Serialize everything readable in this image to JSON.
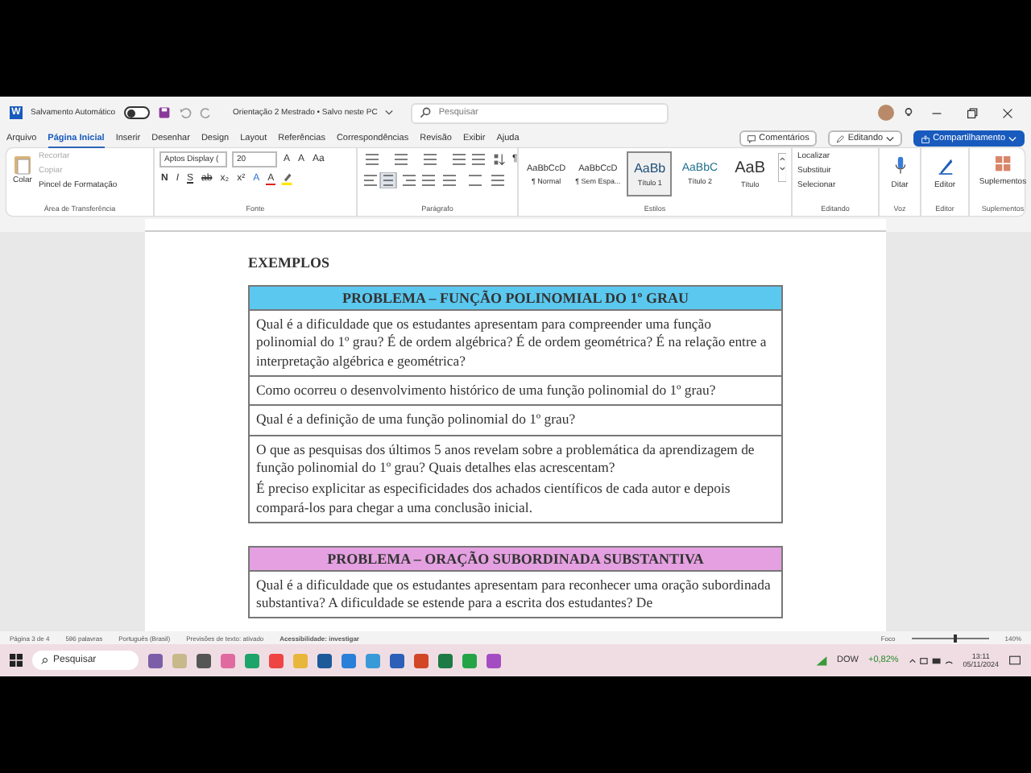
{
  "window": {
    "app_logo": "W",
    "autosave_label": "Salvamento Automático",
    "autosave_on": false,
    "doc_title": "Orientação 2 Mestrado • Salvo neste PC",
    "search_placeholder": "Pesquisar"
  },
  "tabs": [
    {
      "label": "Arquivo",
      "selected": false
    },
    {
      "label": "Página Inicial",
      "selected": true
    },
    {
      "label": "Inserir",
      "selected": false
    },
    {
      "label": "Desenhar",
      "selected": false
    },
    {
      "label": "Design",
      "selected": false
    },
    {
      "label": "Layout",
      "selected": false
    },
    {
      "label": "Referências",
      "selected": false
    },
    {
      "label": "Correspondências",
      "selected": false
    },
    {
      "label": "Revisão",
      "selected": false
    },
    {
      "label": "Exibir",
      "selected": false
    },
    {
      "label": "Ajuda",
      "selected": false
    }
  ],
  "top_buttons": {
    "comments": "Comentários",
    "editing": "Editando",
    "share": "Compartilhamento"
  },
  "clipboard": {
    "paste": "Colar",
    "items": [
      {
        "label": "Recortar",
        "disabled": true
      },
      {
        "label": "Copiar",
        "disabled": true
      },
      {
        "label": "Pincel de Formatação",
        "disabled": false
      }
    ],
    "group": "Área de Transferência"
  },
  "font": {
    "name": "Aptos Display (",
    "size": "20",
    "size_buttons": [
      "A",
      "A",
      "Aa"
    ],
    "format_buttons": [
      "N",
      "I",
      "S",
      "ab",
      "x₂",
      "x²",
      "A",
      "A"
    ],
    "group": "Fonte"
  },
  "paragraph": {
    "pilcrow": "¶",
    "group": "Parágrafo"
  },
  "styles": {
    "items": [
      {
        "preview": "AaBbCcD",
        "name": "¶ Normal",
        "selected": false
      },
      {
        "preview": "AaBbCcD",
        "name": "¶ Sem Espa...",
        "selected": false
      },
      {
        "preview": "AaBb",
        "name": "Título 1",
        "selected": true
      },
      {
        "preview": "AaBbC",
        "name": "Título 2",
        "selected": false
      },
      {
        "preview": "AaB",
        "name": "Título",
        "selected": false
      }
    ],
    "group": "Estilos"
  },
  "editing": {
    "items": [
      "Localizar",
      "Substituir",
      "Selecionar"
    ],
    "group": "Editando"
  },
  "voice": {
    "label": "Ditar",
    "group": "Voz"
  },
  "editor": {
    "label": "Editor",
    "group": "Editor"
  },
  "addins": {
    "label": "Suplementos",
    "group": "Suplementos"
  },
  "document": {
    "heading": "EXEMPLOS",
    "tables": [
      {
        "title": "PROBLEMA – FUNÇÃO POLINOMIAL DO 1º GRAU",
        "color": "#5bc8ef",
        "rows": [
          [
            "Qual é a dificuldade que os estudantes apresentam para compreender uma função polinomial do 1º grau? É de ordem algébrica? É de ordem geométrica? É na relação entre a interpretação algébrica e geométrica?"
          ],
          [
            "Como ocorreu o desenvolvimento histórico de uma função polinomial do 1º grau?"
          ],
          [
            "Qual é a definição de uma função polinomial do 1º grau?"
          ],
          [
            "O que as pesquisas dos últimos 5 anos revelam sobre a problemática da aprendizagem de função polinomial do 1º grau? Quais detalhes elas acrescentam?",
            "É preciso explicitar as especificidades dos achados científicos de cada autor e depois compará-los para chegar a uma conclusão inicial."
          ]
        ]
      },
      {
        "title": "PROBLEMA – ORAÇÃO SUBORDINADA SUBSTANTIVA",
        "color": "#e4a0e0",
        "rows": [
          [
            "Qual é a dificuldade que os estudantes apresentam para reconhecer uma oração subordinada substantiva? A dificuldade se estende para a escrita dos estudantes? De"
          ]
        ]
      }
    ]
  },
  "status_bar": {
    "page": "Página 3 de 4",
    "words": "596 palavras",
    "language": "Português (Brasil)",
    "predictions": "Previsões de texto: ativado",
    "accessibility": "Acessibilidade: investigar",
    "focus": "Foco",
    "zoom": "140%",
    "zoom_slider": {
      "level": 0.55
    }
  },
  "taskbar": {
    "search_placeholder": "Pesquisar",
    "stock_name": "DOW",
    "stock_change": "+0,82%",
    "time": "13:11",
    "date": "05/11/2024"
  }
}
